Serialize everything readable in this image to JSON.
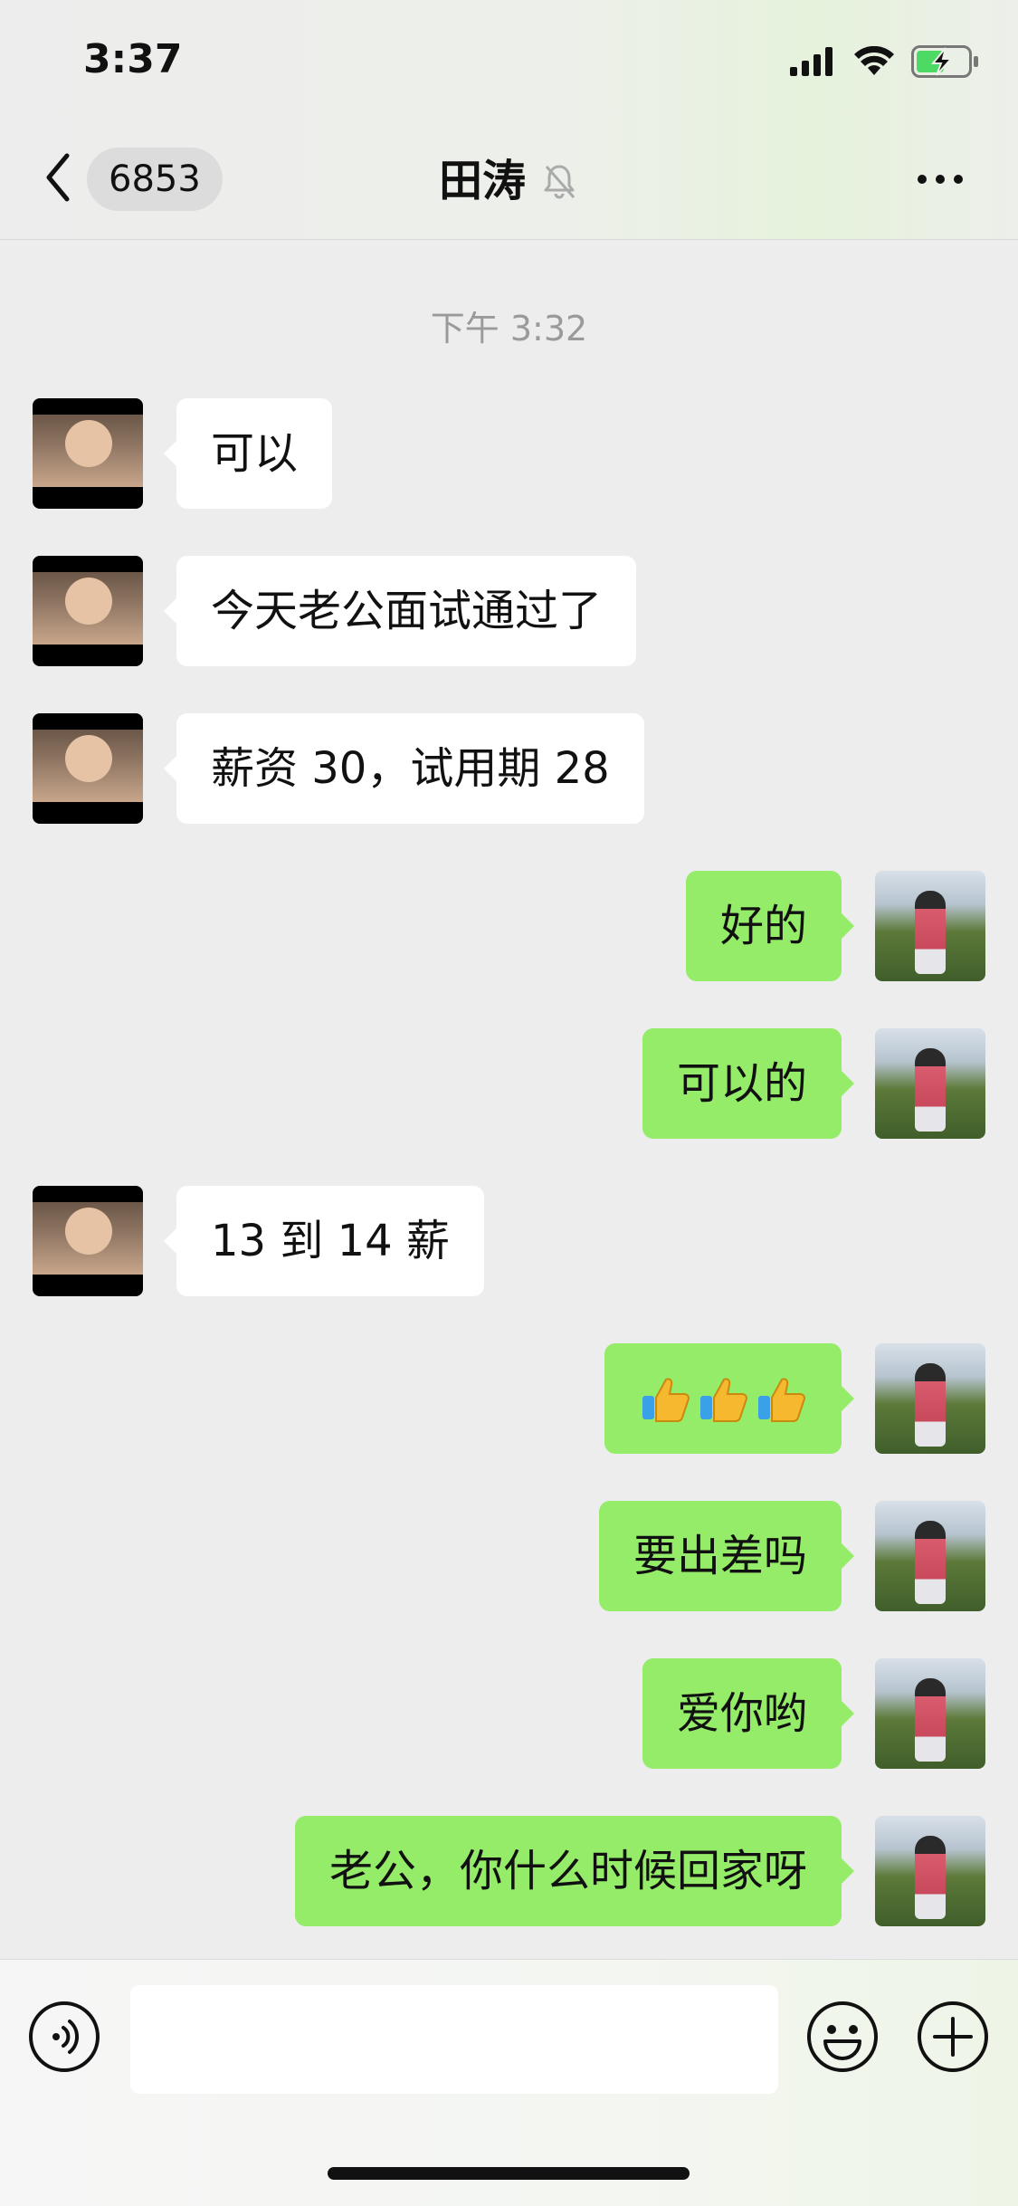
{
  "status_bar": {
    "time": "3:37"
  },
  "header": {
    "unread_count": "6853",
    "title": "田涛"
  },
  "chat": {
    "timestamp": "下午 3:32",
    "messages": [
      {
        "side": "left",
        "text": "可以"
      },
      {
        "side": "left",
        "text": "今天老公面试通过了"
      },
      {
        "side": "left",
        "text": "薪资 30，试用期 28"
      },
      {
        "side": "right",
        "text": "好的"
      },
      {
        "side": "right",
        "text": "可以的"
      },
      {
        "side": "left",
        "text": "13 到 14 薪"
      },
      {
        "side": "right",
        "emoji": "thumbs-up-x3"
      },
      {
        "side": "right",
        "text": "要出差吗"
      },
      {
        "side": "right",
        "text": "爱你哟"
      },
      {
        "side": "right",
        "text": "老公，你什么时候回家呀"
      }
    ]
  },
  "colors": {
    "sent_bubble": "#95ec69",
    "received_bubble": "#ffffff",
    "background": "#ededed"
  }
}
